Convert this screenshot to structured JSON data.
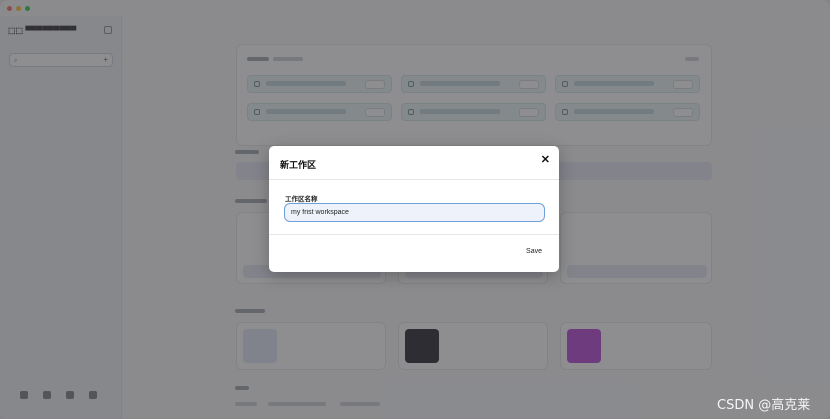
{
  "modal": {
    "title": "新工作区",
    "close_icon": "close-icon",
    "field_label": "工作区名称",
    "field_value": "my frist workspace",
    "save_label": "Save"
  },
  "watermark": "CSDN @高克莱",
  "colors": {
    "overlay": "#3c3c40",
    "input_border": "#6fa0dc",
    "task_bg": "#e6f3f6",
    "traffic_red": "#ff5f57",
    "traffic_yellow": "#febc2e",
    "traffic_green": "#28c840"
  }
}
